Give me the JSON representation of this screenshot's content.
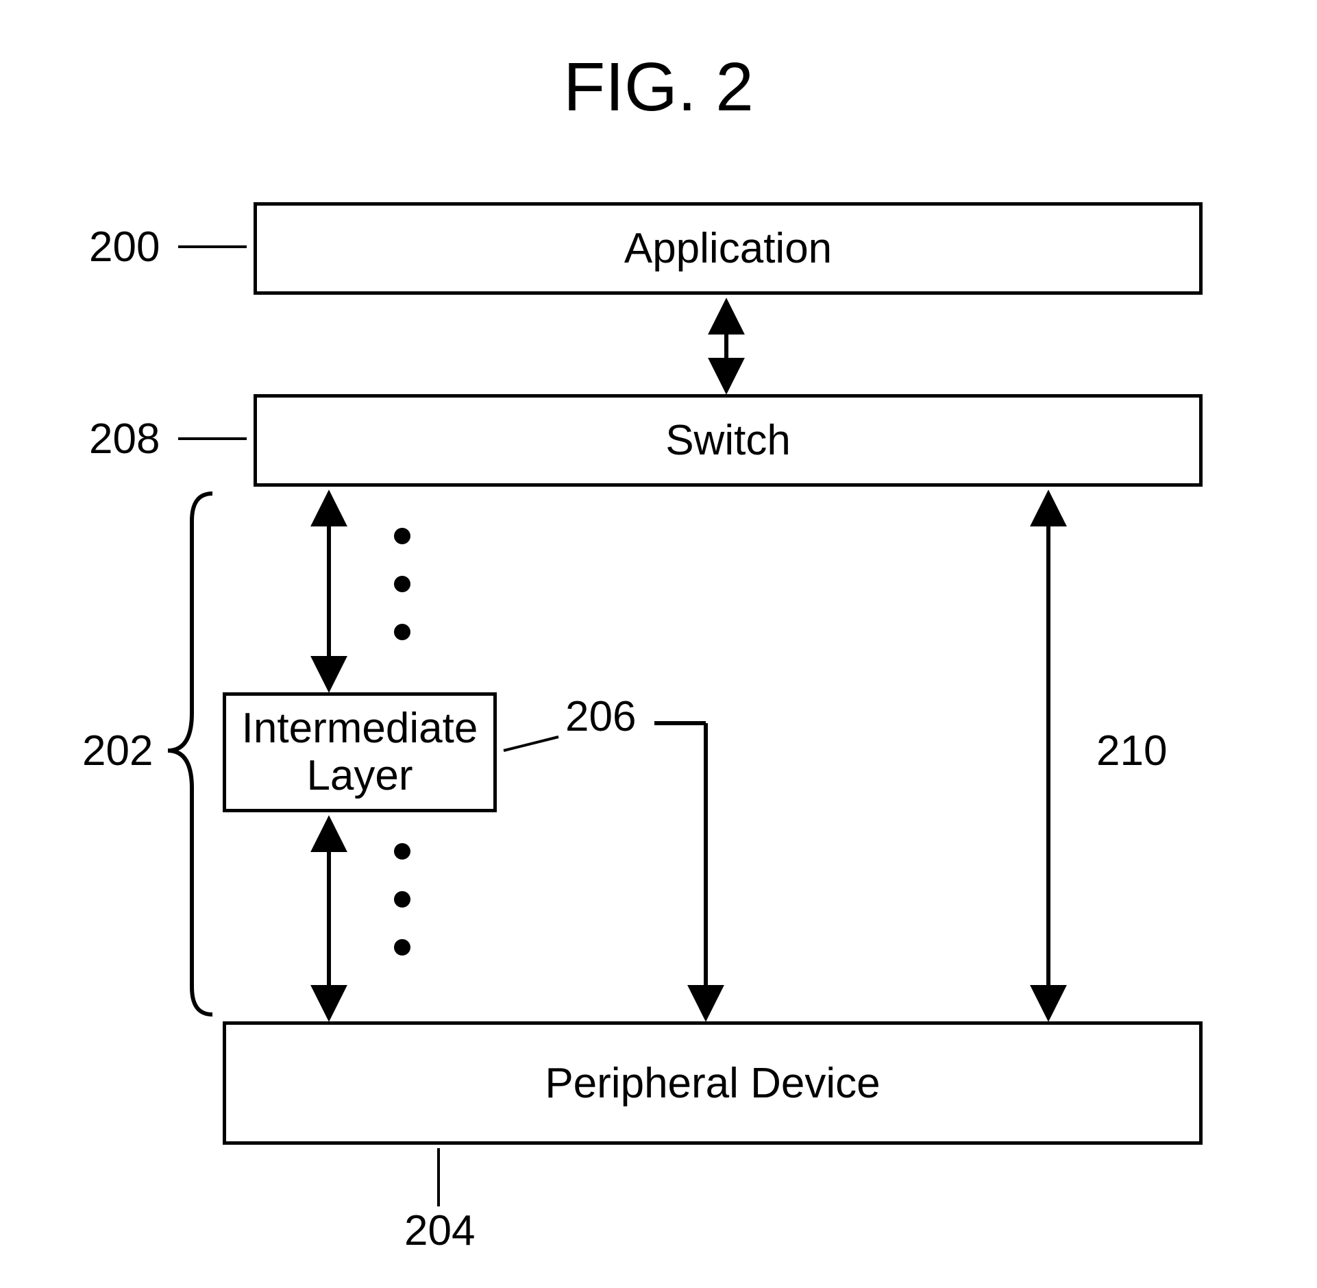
{
  "title": "FIG. 2",
  "boxes": {
    "application": {
      "label": "Application",
      "ref": "200"
    },
    "switch": {
      "label": "Switch",
      "ref": "208"
    },
    "intermediate": {
      "label_line1": "Intermediate",
      "label_line2": "Layer",
      "ref": "206"
    },
    "peripheral": {
      "label": "Peripheral Device",
      "ref": "204"
    }
  },
  "labels": {
    "left_stack": "202",
    "right_arrow": "210"
  }
}
